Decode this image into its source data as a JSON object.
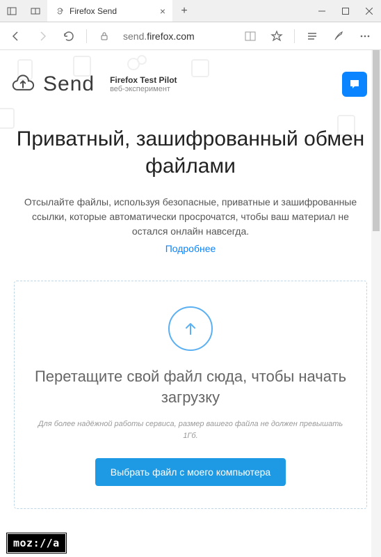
{
  "browser": {
    "tab_title": "Firefox Send",
    "url_host": "firefox.com",
    "url_prefix": "send.",
    "titlebar": {
      "new_tab": "+"
    }
  },
  "header": {
    "logo_text": "Send",
    "pilot_title": "Firefox Test Pilot",
    "pilot_sub": "веб-эксперимент"
  },
  "hero": {
    "title": "Приватный, зашифрованный обмен файлами",
    "desc": "Отсылайте файлы, используя безопасные, приватные и зашифрованные ссылки, которые автоматически просрочатся, чтобы ваш материал не остался онлайн навсегда.",
    "learn_more": "Подробнее"
  },
  "dropzone": {
    "title": "Перетащите свой файл сюда, чтобы начать загрузку",
    "note": "Для более надёжной работы сервиса, размер вашего файла не должен превышать 1Гб.",
    "button": "Выбрать файл с моего компьютера"
  },
  "footer": {
    "mozilla": "moz://a"
  }
}
